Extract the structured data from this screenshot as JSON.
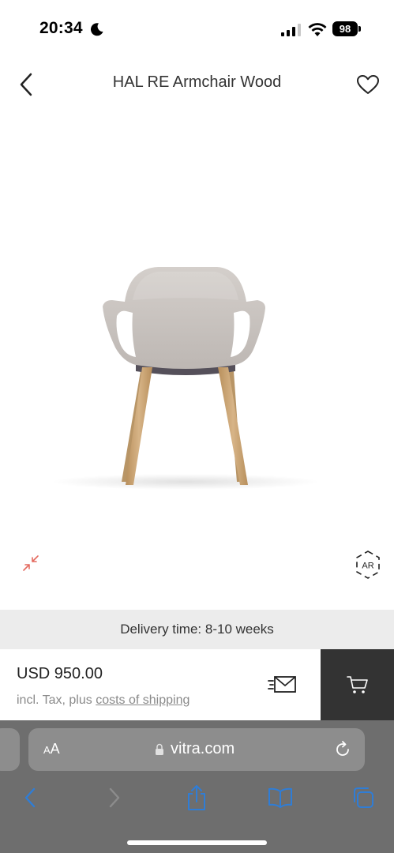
{
  "status_bar": {
    "time": "20:34",
    "battery": "98",
    "icons": [
      "moon-icon",
      "signal-icon",
      "wifi-icon",
      "battery-icon"
    ]
  },
  "header": {
    "title": "HAL RE Armchair Wood",
    "icons": [
      "chevron-left-icon",
      "heart-icon"
    ]
  },
  "product": {
    "icons": [
      "collapse-icon",
      "ar-icon"
    ],
    "ar_label": "AR",
    "colors": {
      "shell": "#cbc5c1",
      "legs": "#c9a77a",
      "accent": "#e46a5f"
    }
  },
  "delivery": {
    "text": "Delivery time: 8-10 weeks"
  },
  "purchase": {
    "price": "USD 950.00",
    "note_prefix": "incl. Tax, plus ",
    "shipping_link": "costs of shipping",
    "icons": [
      "send-enquiry-icon",
      "cart-icon"
    ]
  },
  "browser": {
    "text_size_label_small": "A",
    "text_size_label_large": "A",
    "url": "vitra.com",
    "icons": [
      "lock-icon",
      "reload-icon",
      "back-icon",
      "forward-icon",
      "share-icon",
      "bookmarks-icon",
      "tabs-icon"
    ],
    "accent": "#2f7dd6"
  }
}
